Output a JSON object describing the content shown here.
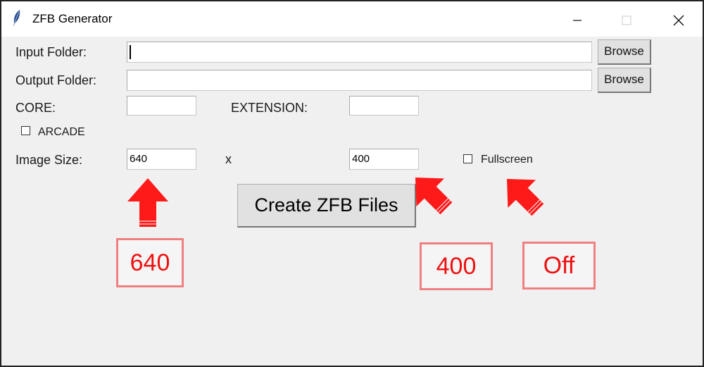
{
  "window": {
    "title": "ZFB Generator"
  },
  "form": {
    "input_folder_label": "Input Folder:",
    "output_folder_label": "Output Folder:",
    "browse_label": "Browse",
    "core_label": "CORE:",
    "extension_label": "EXTENSION:",
    "arcade_label": "ARCADE",
    "arcade_checked": false,
    "image_size_label": "Image Size:",
    "width_value": "640",
    "x_label": "x",
    "height_value": "400",
    "fullscreen_label": "Fullscreen",
    "fullscreen_checked": false,
    "create_button_label": "Create ZFB Files"
  },
  "annotations": {
    "width_callout": "640",
    "height_callout": "400",
    "fullscreen_callout": "Off",
    "color": "#ff1a1a"
  },
  "icons": [
    "feather-icon",
    "minimize-icon",
    "maximize-icon",
    "close-icon",
    "red-arrow-icon"
  ]
}
